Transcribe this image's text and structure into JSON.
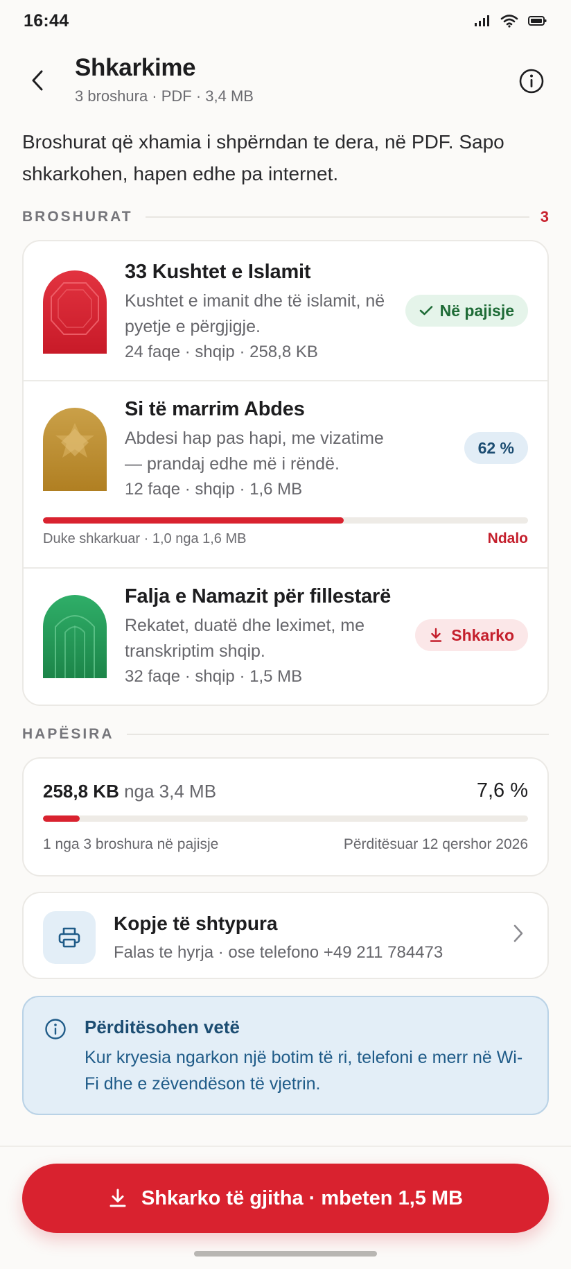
{
  "status": {
    "time": "16:44"
  },
  "header": {
    "title": "Shkarkime",
    "subtitle": "3 broshura · PDF · 3,4 MB"
  },
  "intro": "Broshurat që xhamia i shpërndan te dera, në PDF. Sapo shkarkohen, hapen edhe pa internet.",
  "brochures_section": {
    "label": "BROSHURAT",
    "count": "3"
  },
  "brochures": [
    {
      "title": "33 Kushtet e Islamit",
      "desc": "Kushtet e imanit dhe të islamit, në pyetje e përgjigje.",
      "meta": "24 faqe · shqip · 258,8 KB",
      "status": "Në pajisje",
      "color": "#d8202e"
    },
    {
      "title": "Si të marrim Abdes",
      "desc": "Abdesi hap pas hapi, me vizatime — prandaj edhe më i rëndë.",
      "meta": "12 faqe · shqip · 1,6 MB",
      "status": "62 %",
      "progress": 0.62,
      "progress_label": "Duke shkarkuar · 1,0 nga 1,6 MB",
      "stop_label": "Ndalo",
      "color": "#c4922f"
    },
    {
      "title": "Falja e Namazit për fillestarë",
      "desc": "Rekatet, duatë dhe leximet, me transkriptim shqip.",
      "meta": "32 faqe · shqip · 1,5 MB",
      "status": "Shkarko",
      "color": "#249a58"
    }
  ],
  "storage_section": {
    "label": "HAPËSIRA"
  },
  "storage": {
    "used": "258,8 KB",
    "of": "nga 3,4 MB",
    "percent": "7,6 %",
    "fraction": 0.076,
    "left_note": "1 nga 3 broshura në pajisje",
    "right_note": "Përditësuar 12 qershor 2026"
  },
  "print": {
    "title": "Kopje të shtypura",
    "sub": "Falas te hyrja · ose telefono +49 211 784473"
  },
  "info": {
    "title": "Përditësohen vetë",
    "text": "Kur kryesia ngarkon një botim të ri, telefoni e merr në Wi-Fi dhe e zëvendëson të vjetrin."
  },
  "cta": {
    "label": "Shkarko të gjitha · mbeten 1,5 MB"
  },
  "colors": {
    "accent": "#d9222f",
    "info": "#1c4d72",
    "success": "#1e6b36"
  }
}
